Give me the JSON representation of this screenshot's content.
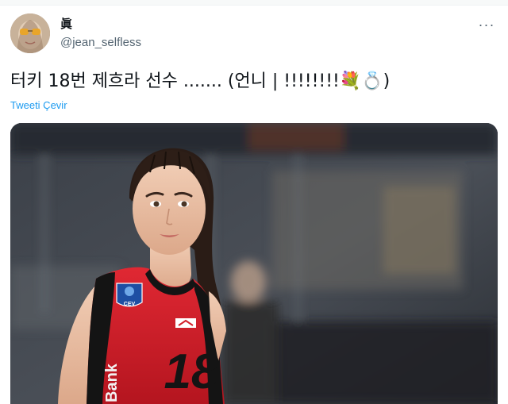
{
  "tweet": {
    "display_name": "眞",
    "handle": "@jean_selfless",
    "more_icon": "more-horizontal-icon",
    "text": "터키 18번 제흐라 선수 ....... (언니 | !!!!!!!!💐💍)",
    "translate_label": "Tweeti Çevir",
    "photo": {
      "jersey_number": "18",
      "sponsor_text": "Bank",
      "badge_text": "CEV"
    }
  },
  "colors": {
    "link": "#1d9bf0",
    "secondary_text": "#536471",
    "jersey_red": "#d3202a",
    "jersey_black": "#141414"
  }
}
